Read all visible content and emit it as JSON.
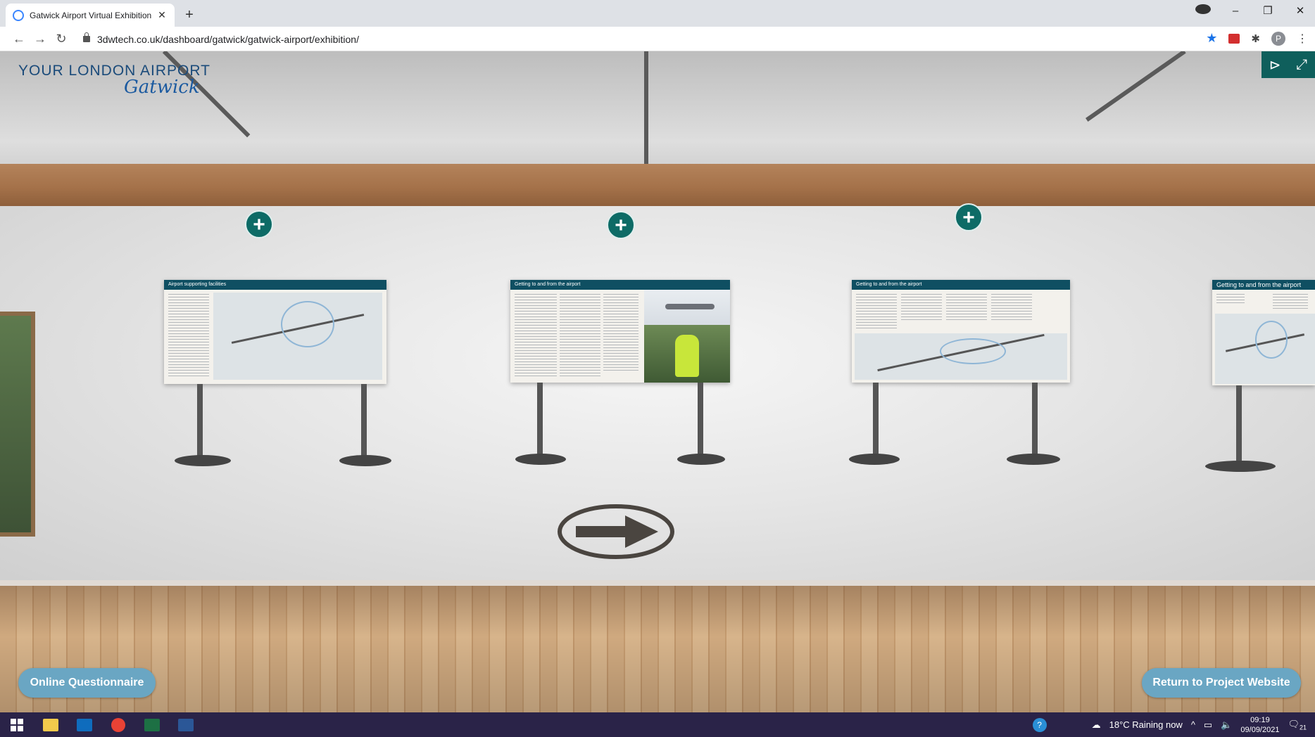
{
  "browser": {
    "tab_title": "Gatwick Airport Virtual Exhibition",
    "url": "3dwtech.co.uk/dashboard/gatwick/gatwick-airport/exhibition/",
    "profile_initial": "P"
  },
  "logo": {
    "line1": "YOUR LONDON AIRPORT",
    "line2": "Gatwick"
  },
  "panels": [
    {
      "title": "Airport supporting facilities"
    },
    {
      "title": "Getting to and from the airport"
    },
    {
      "title": "Getting to and from the airport"
    },
    {
      "title": "Getting to and from the airport"
    }
  ],
  "buttons": {
    "questionnaire": "Online Questionnaire",
    "return": "Return to Project Website"
  },
  "taskbar": {
    "weather": "18°C  Raining now",
    "time": "09:19",
    "date": "09/09/2021",
    "notifications": "21"
  },
  "colors": {
    "accent": "#0d6b66",
    "pill": "#6aa6c3",
    "taskbar": "#2a2348"
  }
}
